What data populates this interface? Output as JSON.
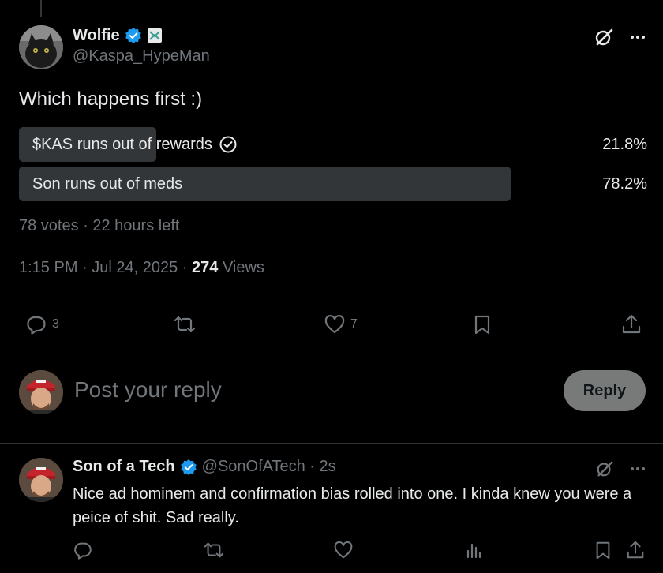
{
  "post": {
    "author_name": "Wolfie",
    "handle": "@Kaspa_HypeMan",
    "text": "Which happens first :)",
    "poll": {
      "options": [
        {
          "label": "$KAS runs out of rewards",
          "percent_text": "21.8%",
          "percent": 21.8,
          "selected": true
        },
        {
          "label": "Son runs out of meds",
          "percent_text": "78.2%",
          "percent": 78.2,
          "selected": false
        }
      ],
      "meta": "78 votes · 22 hours left"
    },
    "timestamp": "1:15 PM · Jul 24, 2025 · ",
    "views_count": "274",
    "views_label": " Views",
    "counts": {
      "replies": "3",
      "likes": "7"
    }
  },
  "composer": {
    "placeholder": "Post your reply",
    "reply_button": "Reply"
  },
  "reply": {
    "author_name": "Son of a Tech",
    "handle_time": "@SonOfATech · 2s",
    "text": "Nice ad hominem and confirmation bias rolled into one. I kinda knew you were a peice of shit. Sad really."
  },
  "colors": {
    "background": "#000000",
    "text_primary": "#e7e9ea",
    "text_secondary": "#71767b",
    "poll_fill": "#333639",
    "verified": "#1d9bf0",
    "reply_button": "#787a7a"
  },
  "icons": [
    "verified-badge-icon",
    "grok-icon",
    "more-icon",
    "reply-icon",
    "repost-icon",
    "like-icon",
    "bookmark-icon",
    "share-icon",
    "analytics-icon",
    "check-circle-icon"
  ]
}
